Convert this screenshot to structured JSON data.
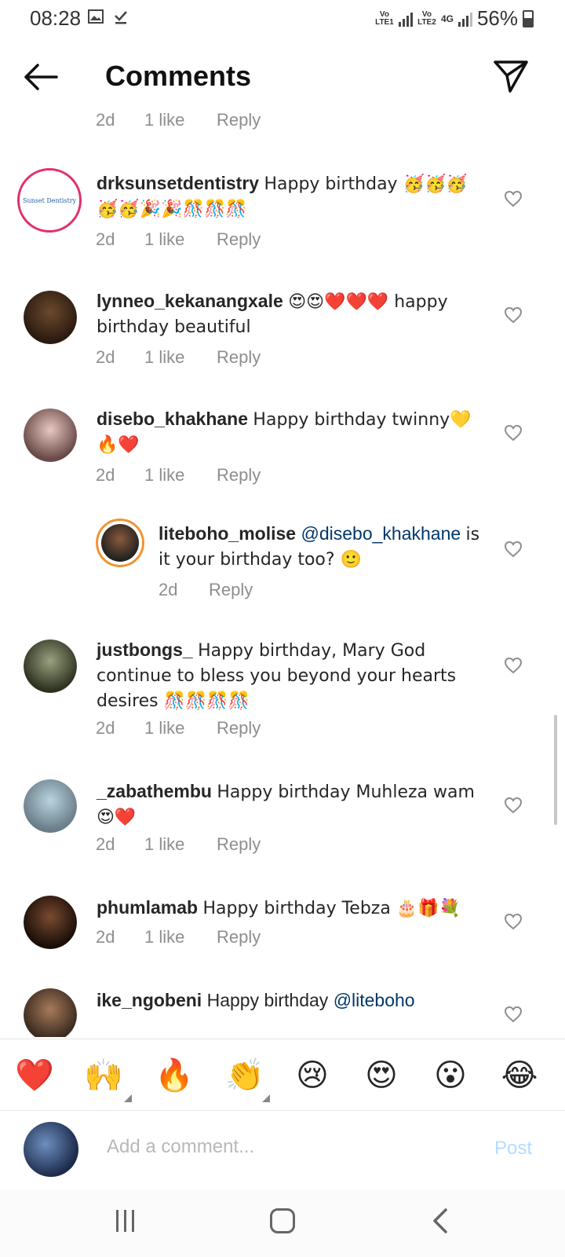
{
  "status_bar": {
    "time": "08:28",
    "network1": "Vo LTE1",
    "network2": "Vo LTE2",
    "net_type": "4G",
    "battery": "56%"
  },
  "header": {
    "title": "Comments",
    "back_icon": "arrow-left-icon",
    "share_icon": "paper-plane-icon"
  },
  "top_partial_meta": {
    "age": "2d",
    "likes": "1 like",
    "reply": "Reply"
  },
  "comments": [
    {
      "user": "drksunsetdentistry",
      "text": "Happy birthday 🥳🥳🥳🥳🥳🎉🎉🎊🎊🎊",
      "avatar_label": "Sunset Dentistry",
      "age": "2d",
      "likes": "1 like",
      "reply": "Reply"
    },
    {
      "user": "lynneo_kekanangxale",
      "text": "😍😍❤️❤️❤️ happy birthday beautiful",
      "age": "2d",
      "likes": "1 like",
      "reply": "Reply"
    },
    {
      "user": "disebo_khakhane",
      "text": "Happy birthday twinny💛🔥❤️",
      "age": "2d",
      "likes": "1 like",
      "reply": "Reply"
    },
    {
      "user": "liteboho_molise",
      "mention": "@disebo_khakhane",
      "text": "is it your birthday too? 🙂",
      "age": "2d",
      "reply": "Reply"
    },
    {
      "user": "justbongs_",
      "text": "Happy birthday, Mary God continue to bless you beyond your hearts desires 🎊🎊🎊🎊",
      "age": "2d",
      "likes": "1 like",
      "reply": "Reply"
    },
    {
      "user": "_zabathembu",
      "text": "Happy birthday Muhleza wam 😍❤️",
      "age": "2d",
      "likes": "1 like",
      "reply": "Reply"
    },
    {
      "user": "phumlamab",
      "text": "Happy birthday Tebza 🎂🎁💐",
      "age": "2d",
      "likes": "1 like",
      "reply": "Reply"
    },
    {
      "user": "ike_ngobeni",
      "text": "Happy birthday",
      "mention": "@liteboho"
    }
  ],
  "emoji_bar": [
    "❤️",
    "🙌",
    "🔥",
    "👏",
    "😢",
    "😍",
    "😮",
    "😂"
  ],
  "input": {
    "placeholder": "Add a comment...",
    "post_label": "Post"
  },
  "colors": {
    "link": "#00376b",
    "muted": "#8e8e8e",
    "post_disabled": "#b3dbff",
    "ring": "#d6249f"
  }
}
